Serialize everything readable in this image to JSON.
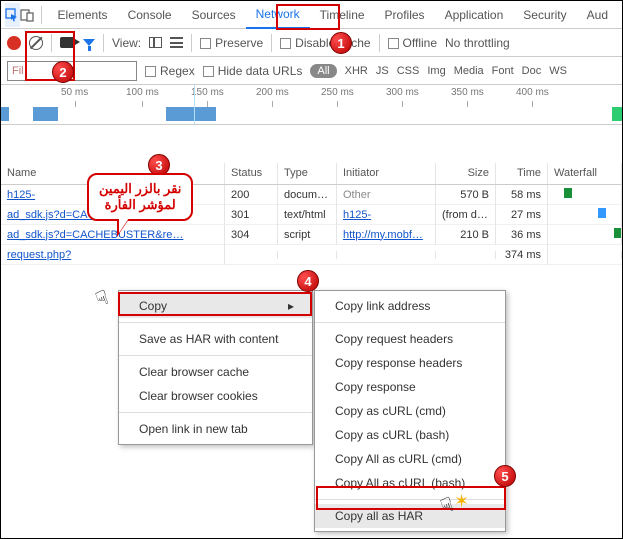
{
  "tabs": {
    "elements": "Elements",
    "console": "Console",
    "sources": "Sources",
    "network": "Network",
    "timeline": "Timeline",
    "profiles": "Profiles",
    "application": "Application",
    "security": "Security",
    "audits": "Aud"
  },
  "toolbar": {
    "view": "View:",
    "preserve": "Preserve",
    "disable_cache": "Disable cache",
    "offline": "Offline",
    "throttle": "No throttling"
  },
  "filterbar": {
    "placeholder": "Fil",
    "regex": "Regex",
    "hide": "Hide data URLs",
    "all": "All",
    "types": [
      "XHR",
      "JS",
      "CSS",
      "Img",
      "Media",
      "Font",
      "Doc",
      "WS"
    ]
  },
  "timeline": {
    "ticks": [
      "50 ms",
      "100 ms",
      "150 ms",
      "200 ms",
      "250 ms",
      "300 ms",
      "350 ms",
      "400 ms"
    ]
  },
  "headers": {
    "name": "Name",
    "status": "Status",
    "type": "Type",
    "initiator": "Initiator",
    "size": "Size",
    "time": "Time",
    "waterfall": "Waterfall"
  },
  "rows": [
    {
      "name": "h125-",
      "status": "200",
      "type": "docume…",
      "initiator": "Other",
      "initOther": true,
      "size": "570 B",
      "time": "58 ms",
      "wleft": 10,
      "wcolor": "#1a8f3a"
    },
    {
      "name": "ad_sdk.js?d=CACHEBUSTER&re…",
      "status": "301",
      "type": "text/html",
      "initiator": "h125-",
      "initOther": false,
      "size": "(from di…",
      "time": "27 ms",
      "wleft": 44,
      "wcolor": "#3399ff"
    },
    {
      "name": "ad_sdk.js?d=CACHEBUSTER&re…",
      "status": "304",
      "type": "script",
      "initiator": "http://my.mobf…",
      "initOther": false,
      "size": "210 B",
      "time": "36 ms",
      "wleft": 60,
      "wcolor": "#1a8f3a"
    },
    {
      "name": "request.php?",
      "status": "",
      "type": "",
      "initiator": "",
      "initOther": false,
      "size": "",
      "time": "374 ms",
      "wleft": 0,
      "wcolor": ""
    }
  ],
  "menu1": {
    "copy": "Copy",
    "save_har": "Save as HAR with content",
    "clear_cache": "Clear browser cache",
    "clear_cookies": "Clear browser cookies",
    "open_tab": "Open link in new tab"
  },
  "menu2": {
    "copy_link": "Copy link address",
    "copy_req_h": "Copy request headers",
    "copy_res_h": "Copy response headers",
    "copy_res": "Copy response",
    "curl_cmd": "Copy as cURL (cmd)",
    "curl_bash": "Copy as cURL (bash)",
    "curl_all_cmd": "Copy All as cURL (cmd)",
    "curl_all_bash": "Copy All as cURL (bash)",
    "copy_all_har": "Copy all as HAR"
  },
  "callout": {
    "line1": "نقر بالزر اليمين",
    "line2": "لمؤشر الفأرة"
  }
}
